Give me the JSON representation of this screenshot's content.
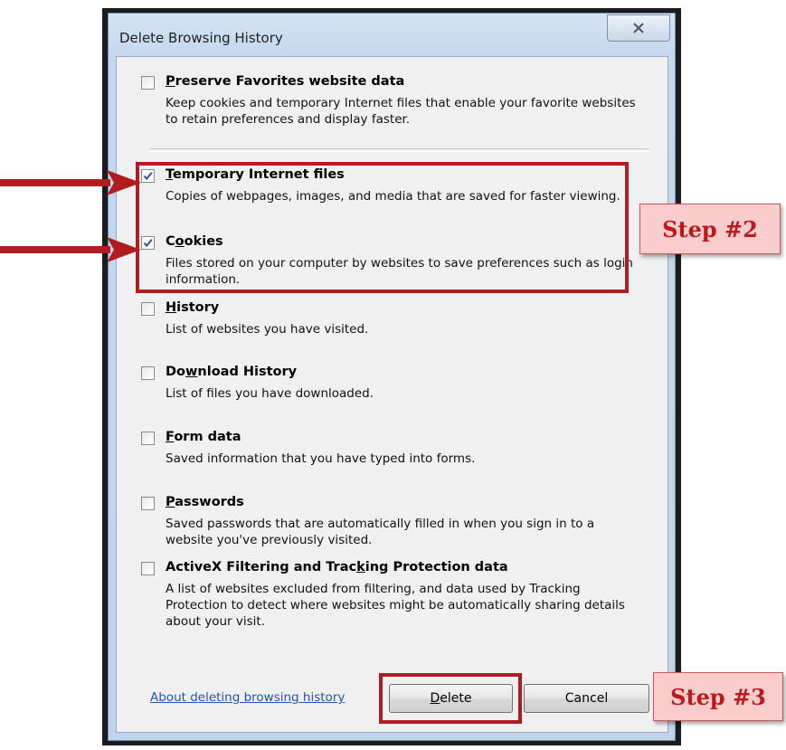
{
  "dialog": {
    "title": "Delete Browsing History",
    "close_glyph": "X"
  },
  "options": [
    {
      "label": "Preserve Favorites website data",
      "access_key": "P",
      "description": "Keep cookies and temporary Internet files that enable your favorite websites to retain preferences and display faster.",
      "checked": false
    },
    {
      "label": "Temporary Internet files",
      "access_key": "T",
      "description": "Copies of webpages, images, and media that are saved for faster viewing.",
      "checked": true
    },
    {
      "label": "Cookies",
      "access_key": "o",
      "description": "Files stored on your computer by websites to save preferences such as login information.",
      "checked": true
    },
    {
      "label": "History",
      "access_key": "H",
      "description": "List of websites you have visited.",
      "checked": false
    },
    {
      "label": "Download History",
      "access_key": "w",
      "description": "List of files you have downloaded.",
      "checked": false
    },
    {
      "label": "Form data",
      "access_key": "F",
      "description": "Saved information that you have typed into forms.",
      "checked": false
    },
    {
      "label": "Passwords",
      "access_key": "P",
      "description": "Saved passwords that are automatically filled in when you sign in to a website you've previously visited.",
      "checked": false
    },
    {
      "label": "ActiveX Filtering and Tracking Protection data",
      "access_key": "k",
      "description": "A list of websites excluded from filtering, and data used by Tracking Protection to detect where websites might be automatically sharing details about your visit.",
      "checked": false
    }
  ],
  "footer": {
    "help_link": "About deleting browsing history",
    "delete_label": "Delete",
    "cancel_label": "Cancel"
  },
  "annotations": {
    "step2": "Step #2",
    "step3": "Step #3",
    "highlight_color": "#b01c20"
  }
}
